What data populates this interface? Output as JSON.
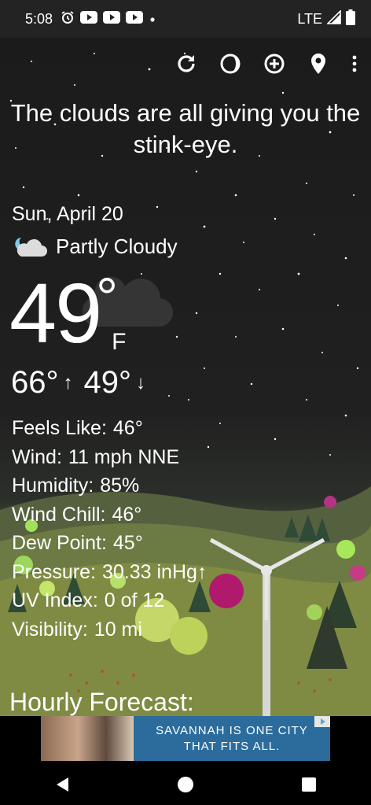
{
  "status_bar": {
    "time": "5:08",
    "network": "LTE",
    "icons": [
      "alarm-icon",
      "youtube-icon",
      "youtube-icon",
      "youtube-icon",
      "notification-dot-icon",
      "signal-icon",
      "battery-icon"
    ]
  },
  "toolbar": {
    "icons": [
      "refresh-icon",
      "theme-icon",
      "add-icon",
      "location-icon",
      "more-icon"
    ]
  },
  "headline": "The clouds are all giving you the stink-eye.",
  "weather": {
    "date": "Sun, April 20",
    "condition": "Partly Cloudy",
    "condition_icon": "partly-cloudy-night-icon",
    "temperature": "49",
    "degree_symbol": "°",
    "unit": "F",
    "high": "66°",
    "low": "49°",
    "high_arrow": "↑",
    "low_arrow": "↓"
  },
  "details": [
    {
      "label": "Feels Like:",
      "value": "46°"
    },
    {
      "label": "Wind:",
      "value": "11 mph NNE"
    },
    {
      "label": "Humidity:",
      "value": "85%"
    },
    {
      "label": "Wind Chill:",
      "value": "46°"
    },
    {
      "label": "Dew Point:",
      "value": "45°"
    },
    {
      "label": "Pressure:",
      "value": "30.33 inHg↑"
    },
    {
      "label": "UV Index:",
      "value": "0 of 12"
    },
    {
      "label": "Visibility:",
      "value": "10 mi"
    }
  ],
  "hourly_title": "Hourly Forecast:",
  "ad": {
    "line1": "SAVANNAH IS ONE CITY",
    "line2": "THAT FITS ALL."
  },
  "colors": {
    "sky": "#1b1b1b",
    "grass": "#7f8a40",
    "ad_background": "#2b6c9c",
    "status_bar": "#232323"
  }
}
